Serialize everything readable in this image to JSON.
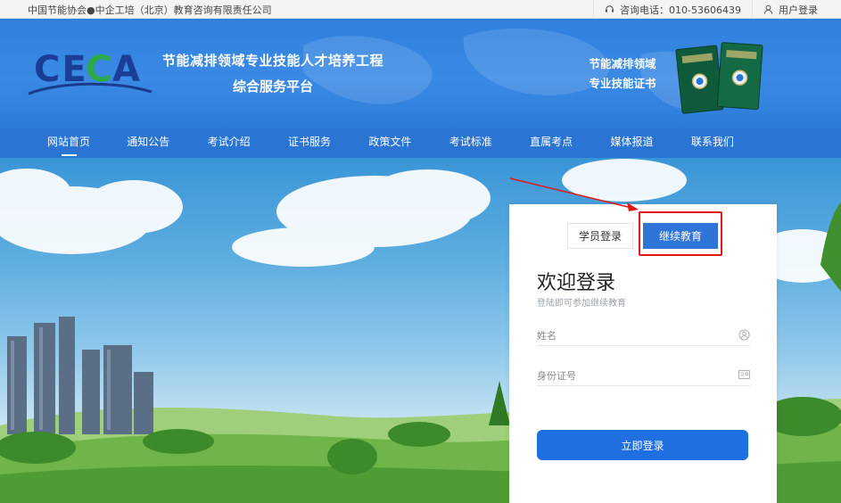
{
  "topbar": {
    "org": "中国节能协会●中企工培（北京）教育咨询有限责任公司",
    "phone_label": "咨询电话：010-53606439",
    "login_label": "用户登录"
  },
  "header": {
    "logo_text": "CECA",
    "title_line1": "节能减排领域专业技能人才培养工程",
    "title_line2": "综合服务平台",
    "cert_line1": "节能减排领域",
    "cert_line2": "专业技能证书"
  },
  "nav": {
    "items": [
      "网站首页",
      "通知公告",
      "考试介绍",
      "证书服务",
      "政策文件",
      "考试标准",
      "直属考点",
      "媒体报道",
      "联系我们"
    ],
    "active_index": 0
  },
  "login": {
    "tab_student": "学员登录",
    "tab_continuing": "继续教育",
    "active_tab": "继续教育",
    "title": "欢迎登录",
    "subtitle": "登陆即可参加继续教育",
    "name_placeholder": "姓名",
    "id_placeholder": "身份证号",
    "submit_label": "立即登录"
  },
  "colors": {
    "header_blue": "#2f7fdd",
    "nav_blue": "#2a74d4",
    "button_blue": "#1f6fe0",
    "highlight_red": "#e01818"
  }
}
